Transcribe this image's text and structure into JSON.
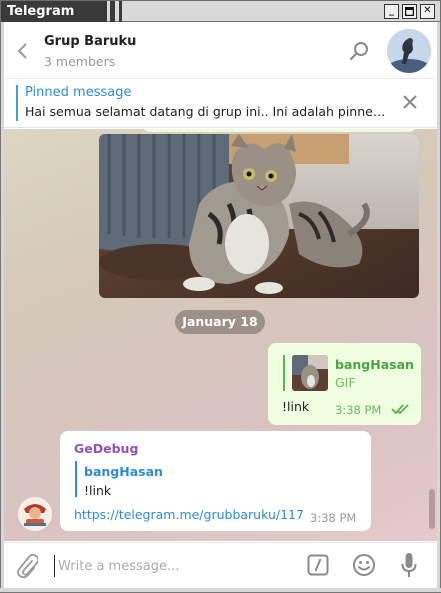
{
  "window": {
    "title": "Telegram",
    "buttons": [
      "_",
      "▫",
      "✕"
    ]
  },
  "header": {
    "chat_name": "Grup Baruku",
    "subtitle": "3 members",
    "icons": [
      "back-arrow-icon",
      "search-icon",
      "group-avatar"
    ]
  },
  "pinned": {
    "title": "Pinned message",
    "text": "Hai semua selamat datang di grup ini..  Ini adalah pinne…",
    "close_icon": "close-icon"
  },
  "messages": {
    "date_separator": "January 18",
    "outgoing": {
      "quote_author": "bangHasan",
      "quote_kind": "GIF",
      "text": "!link",
      "time": "3:38 PM",
      "status_icon": "double-check-icon"
    },
    "incoming": {
      "sender": "GeDebug",
      "quote_author": "bangHasan",
      "quote_text": "!link",
      "link": "https://telegram.me/grubbaruku/117",
      "time": "3:38 PM"
    }
  },
  "composer": {
    "placeholder": "Write a message...",
    "icons": [
      "attach-icon",
      "bot-command-icon",
      "emoji-icon",
      "mic-icon"
    ]
  },
  "colors": {
    "accent_blue": "#2f8dcf",
    "outgoing_bubble": "#effee0",
    "outgoing_accent": "#4da340",
    "sender_purple": "#8e54b5",
    "date_pill": "#8a7e76"
  }
}
